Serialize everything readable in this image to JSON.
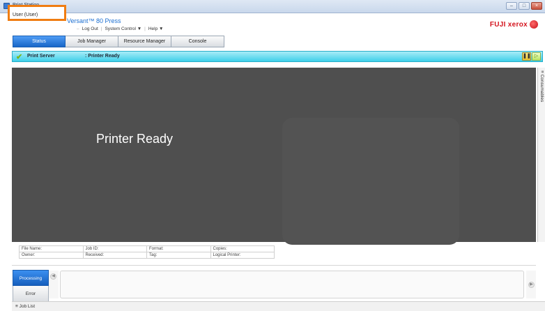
{
  "window": {
    "title": "Print Station",
    "controls": [
      "–",
      "□",
      "×"
    ]
  },
  "header": {
    "user": "User (User)",
    "product": "Versant™ 80 Press",
    "menu": {
      "logout": "Log Out",
      "system_control": "System Control ▼",
      "help": "Help ▼"
    },
    "brand": "FUJI xerox"
  },
  "tabs": [
    {
      "label": "Status",
      "active": true
    },
    {
      "label": "Job Manager",
      "active": false
    },
    {
      "label": "Resource Manager",
      "active": false
    },
    {
      "label": "Console",
      "active": false
    }
  ],
  "status_bar": {
    "server_label": "Print Server",
    "status": ": Printer Ready",
    "pause_symbol": "❚❚",
    "play_symbol": "▷"
  },
  "main": {
    "message": "Printer Ready"
  },
  "side_tab": {
    "label": "≡ Consumables"
  },
  "job_info": {
    "row1": [
      "File Name:",
      "Job ID:",
      "Format:",
      "Copies:"
    ],
    "row2": [
      "Owner:",
      "Received:",
      "Tag:",
      "Logical Printer:"
    ]
  },
  "bottom": {
    "processing": "Processing",
    "error": "Error",
    "left_arrow": "◀",
    "right_arrow": "▶",
    "job_list": "≡ Job List"
  },
  "colors": {
    "accent": "#1866c7",
    "status_bar": "#3fd0ea",
    "highlight": "#f07d12",
    "brand": "#d4141e"
  }
}
